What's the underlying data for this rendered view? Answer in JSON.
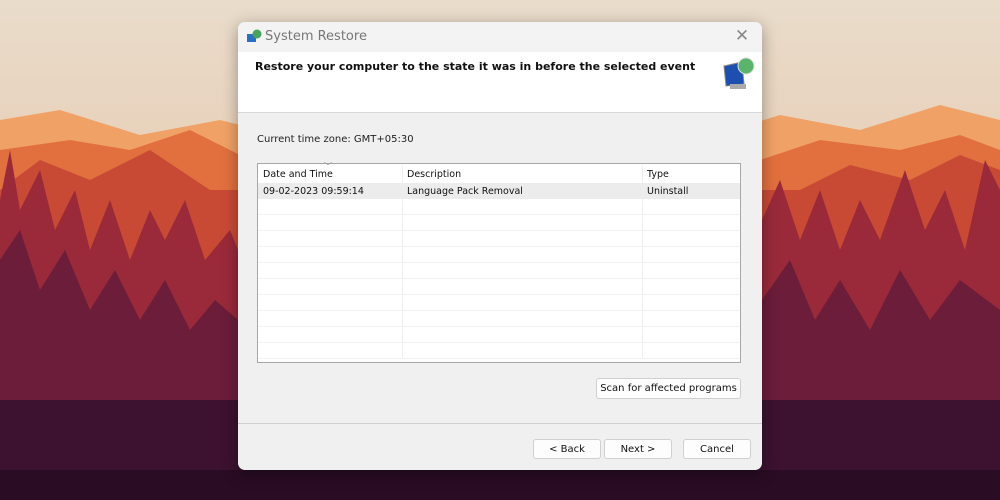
{
  "window": {
    "title": "System Restore",
    "close_icon": "close-icon"
  },
  "header": {
    "text": "Restore your computer to the state it was in before the selected event",
    "icon": "system-restore-icon"
  },
  "timezone": "Current time zone: GMT+05:30",
  "table": {
    "columns": [
      "Date and Time",
      "Description",
      "Type"
    ],
    "rows": [
      {
        "date": "09-02-2023 09:59:14",
        "description": "Language Pack Removal",
        "type": "Uninstall"
      }
    ]
  },
  "buttons": {
    "scan": "Scan for affected programs",
    "back": "< Back",
    "next": "Next >",
    "cancel": "Cancel"
  }
}
